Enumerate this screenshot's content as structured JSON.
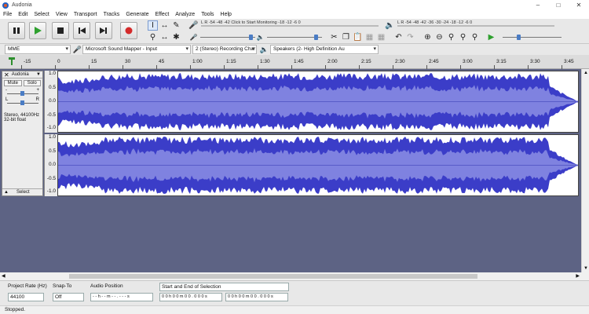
{
  "window": {
    "title": "Audonia"
  },
  "menu": [
    "File",
    "Edit",
    "Select",
    "View",
    "Transport",
    "Tracks",
    "Generate",
    "Effect",
    "Analyze",
    "Tools",
    "Help"
  ],
  "meters": {
    "record_scale": "L  R  -54   -48   -42   Click to Start Monitoring    -18   -12    -6    0",
    "playback_scale": "L  R  -54   -48   -42   -36   -30   -24   -18   -12    -6    0"
  },
  "devices": {
    "host": "MME",
    "input": "Microsoft Sound Mapper - Input",
    "channels": "2 (Stereo) Recording Char",
    "output": "Speakers (2- High Definition Au"
  },
  "timeline": {
    "labels": [
      "-15",
      "0",
      "15",
      "30",
      "45",
      "1:00",
      "1:15",
      "1:30",
      "1:45",
      "2:00",
      "2:15",
      "2:30",
      "2:45",
      "3:00",
      "3:15",
      "3:30",
      "3:45"
    ]
  },
  "track": {
    "name": "Audonia",
    "mute_label": "Mute",
    "solo_label": "Solo",
    "gain_minus": "-",
    "gain_plus": "+",
    "pan_left": "L",
    "pan_right": "R",
    "info_line1": "Stereo, 44100Hz",
    "info_line2": "32-bit float",
    "select_label": "Select",
    "y_labels": [
      "1.0",
      "0.5",
      "0.0",
      "-0.5",
      "-1.0"
    ]
  },
  "selection_toolbar": {
    "project_rate_label": "Project Rate (Hz)",
    "project_rate_value": "44100",
    "snap_to_label": "Snap-To",
    "snap_to_value": "Off",
    "audio_position_label": "Audio Position",
    "audio_position_value": "- - h - - m - - . - - - s",
    "selection_mode": "Start and End of Selection",
    "selection_start": "0 0 h 0 0 m 0 0 . 0 0 0 s",
    "selection_end": "0 0 h 0 0 m 0 0 . 0 0 0 s"
  },
  "status": {
    "text": "Stopped."
  },
  "colors": {
    "waveform": "#3b3dc8",
    "waveform_rms": "#7f82e0",
    "track_bg": "#5d6384"
  }
}
